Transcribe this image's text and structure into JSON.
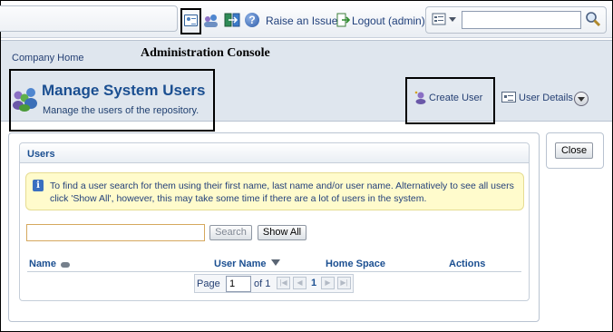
{
  "toolbar": {
    "raise_issue": "Raise an Issue",
    "logout": "Logout (admin)",
    "help_glyph": "?",
    "search_placeholder": "",
    "icons": [
      "admin-console-icon",
      "user-profile-icon",
      "toggle-shelf-icon",
      "help-icon",
      "logout-icon",
      "search-options-icon",
      "search-icon"
    ]
  },
  "header": {
    "breadcrumb": "Company Home",
    "console_title": "Administration Console",
    "page_title": "Manage System Users",
    "page_subtitle": "Manage the users of the repository.",
    "create_user": "Create User",
    "user_details": "User Details"
  },
  "users_panel": {
    "title": "Users",
    "info": "To find a user search for them using their first name, last name and/or user name. Alternatively to see all users click 'Show All', however, this may take some time if there are a lot of users in the system.",
    "info_glyph": "i",
    "search_value": "",
    "search_button": "Search",
    "show_all_button": "Show All",
    "columns": [
      "Name",
      "User Name",
      "Home Space",
      "Actions"
    ],
    "pager": {
      "page_label": "Page",
      "page_value": "1",
      "of_label": "of 1",
      "current": "1"
    }
  },
  "close_button": "Close",
  "colors": {
    "accent": "#1b4f91",
    "header_bg": "#dfe6ee",
    "info_bg": "#fffbcc",
    "link": "#243f73"
  }
}
